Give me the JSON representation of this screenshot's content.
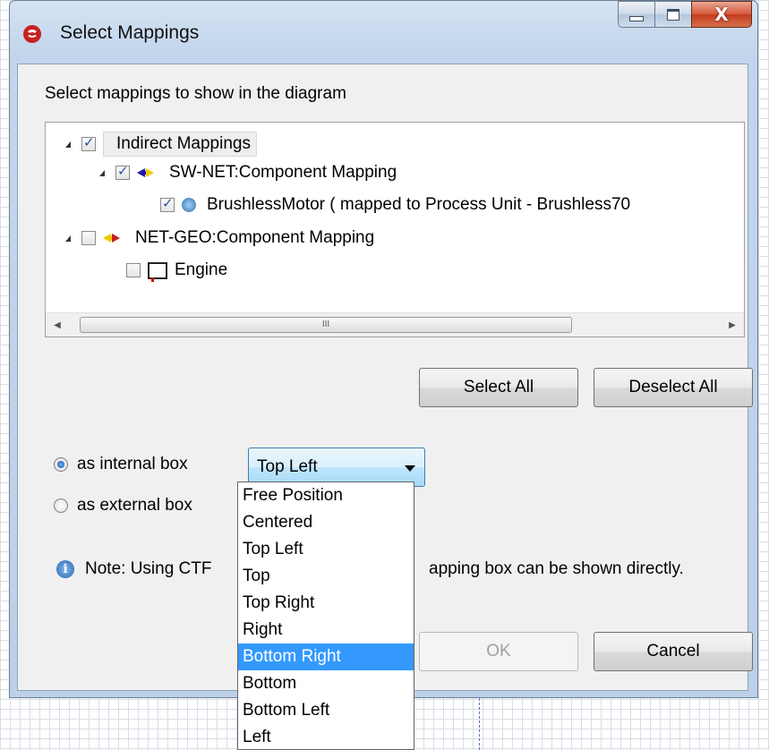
{
  "window": {
    "title": "Select Mappings",
    "close_glyph": "X"
  },
  "instruction": "Select mappings to show in the diagram",
  "tree": {
    "root": {
      "label": "Indirect Mappings",
      "checked": true
    },
    "group1": {
      "label": "SW-NET:Component Mapping",
      "checked": true
    },
    "item1": {
      "label": "BrushlessMotor ( mapped to Process Unit - Brushless70",
      "checked": true
    },
    "group2": {
      "label": "NET-GEO:Component Mapping",
      "checked": false
    },
    "item2": {
      "label": "Engine",
      "checked": false
    },
    "scroll_grip": "III"
  },
  "buttons": {
    "select_all": "Select All",
    "deselect_all": "Deselect All",
    "ok": "OK",
    "cancel": "Cancel"
  },
  "options": {
    "internal_label": "as internal box",
    "external_label": "as external box",
    "selected": "internal"
  },
  "combo": {
    "value": "Top Left",
    "options": [
      "Free Position",
      "Centered",
      "Top Left",
      "Top",
      "Top Right",
      "Right",
      "Bottom Right",
      "Bottom",
      "Bottom Left",
      "Left"
    ],
    "highlighted": "Bottom Right"
  },
  "note": {
    "left": "Note: Using CTF",
    "right": "apping box can be shown directly."
  },
  "colors": {
    "accent": "#3399ff",
    "title_bar": "#c2d5ec",
    "close_button": "#c23b1d"
  }
}
